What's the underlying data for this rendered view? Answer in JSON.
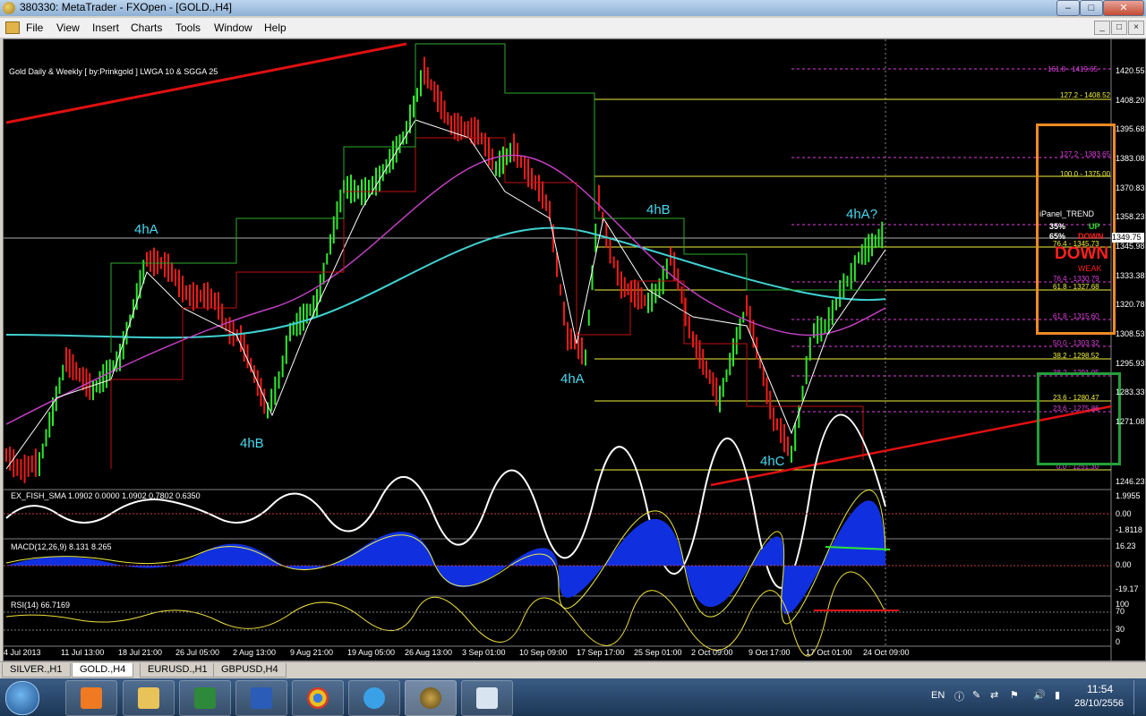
{
  "window": {
    "title": "380330: MetaTrader - FXOpen - [GOLD.,H4]",
    "min": "–",
    "max": "□",
    "close": "✕"
  },
  "menu": [
    "File",
    "View",
    "Insert",
    "Charts",
    "Tools",
    "Window",
    "Help"
  ],
  "mdi_buttons": [
    "_",
    "□",
    "×"
  ],
  "chart": {
    "title": "Gold Daily & Weekly [ by:Prinkgold ] LWGA 10  &  SGGA 25",
    "current_price": "1349.75",
    "wave_labels": [
      "4hA",
      "4hB",
      "4hA",
      "4hB",
      "4hC",
      "4hA?"
    ],
    "fib_labels": [
      {
        "text": "161.8 - 1419.65",
        "color": "#e040e0"
      },
      {
        "text": "127.2 - 1408.52",
        "color": "#f0f040"
      },
      {
        "text": "127.2 - 1383.65",
        "color": "#e040e0"
      },
      {
        "text": "100.0 - 1375.00",
        "color": "#f0f040"
      },
      {
        "text": "76.4 - 1345.73",
        "color": "#f0f040"
      },
      {
        "text": "76.4 - 1330.79",
        "color": "#e040e0"
      },
      {
        "text": "61.8 - 1327.68",
        "color": "#f0f040"
      },
      {
        "text": "61.8 - 1315.60",
        "color": "#e040e0"
      },
      {
        "text": "50.0 - 1303.32",
        "color": "#e040e0"
      },
      {
        "text": "38.2 - 1298.52",
        "color": "#f0f040"
      },
      {
        "text": "38.2 - 1291.05",
        "color": "#e040e0"
      },
      {
        "text": "23.6 - 1280.47",
        "color": "#f0f040"
      },
      {
        "text": "23.6 - 1275.86",
        "color": "#e040e0"
      },
      {
        "text": "0.0 - 1251.30",
        "color": "#e040e0"
      }
    ],
    "price_axis": [
      "1420.55",
      "1408.20",
      "1395.68",
      "1383.08",
      "1370.83",
      "1358.23",
      "1345.98",
      "1333.38",
      "1320.78",
      "1308.53",
      "1295.93",
      "1283.33",
      "1271.08",
      "1246.23"
    ],
    "time_axis": [
      "4 Jul 2013",
      "11 Jul 13:00",
      "18 Jul 21:00",
      "26 Jul 05:00",
      "2 Aug 13:00",
      "9 Aug 21:00",
      "19 Aug 05:00",
      "26 Aug 13:00",
      "3 Sep 01:00",
      "10 Sep 09:00",
      "17 Sep 17:00",
      "25 Sep 01:00",
      "2 Oct 09:00",
      "9 Oct 17:00",
      "17 Oct 01:00",
      "24 Oct 09:00"
    ]
  },
  "trend_panel": {
    "title": "iPanel_TREND",
    "up_pct": "35%",
    "up_label": "UP",
    "down_pct": "65%",
    "down_label": "DOWN",
    "signal": "DOWN",
    "strength": "WEAK",
    "colors": {
      "up": "#22dd22",
      "down": "#ff2020",
      "box": "#f08a24"
    }
  },
  "indicators": {
    "fisher": {
      "label": "EX_FISH_SMA 1.0902 0.0000 1.0902 0.7802 0.6350",
      "axis": [
        "1.9955",
        "0.00",
        "-1.8118"
      ]
    },
    "macd": {
      "label": "MACD(12,26,9) 8.131 8.265",
      "axis": [
        "16.23",
        "0.00",
        "-19.17"
      ]
    },
    "rsi": {
      "label": "RSI(14) 66.7169",
      "axis": [
        "100",
        "70",
        "30",
        "0"
      ]
    }
  },
  "tabs": [
    "SILVER.,H1",
    "GOLD.,H4",
    "EURUSD.,H1",
    "GBPUSD,H4"
  ],
  "active_tab": 1,
  "taskbar": {
    "apps": [
      "media-player",
      "file-explorer",
      "excel",
      "word",
      "chrome",
      "internet-explorer",
      "metatrader",
      "paint"
    ],
    "lang": "EN",
    "time": "11:54",
    "date": "28/10/2556"
  }
}
